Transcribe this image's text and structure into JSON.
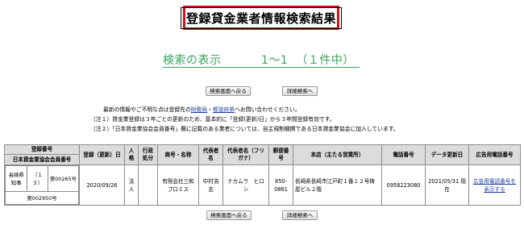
{
  "page": {
    "title": "登録貸金業者情報検索結果",
    "results_label": "検索の表示",
    "results_range": "1〜1",
    "results_count": "（１件中）"
  },
  "buttons": {
    "back": "検索画面へ戻る",
    "detail": "詳細検索へ"
  },
  "notes": {
    "line1_prefix": "最新の情報やご不明な点は登録先の",
    "link_finance": "財務局",
    "separator": "・",
    "link_pref": "都道府県",
    "line1_suffix": "へお問い合わせください。",
    "line2": "（注１）貸金業登録は３年ごとの更新のため、基本的に「登録(更新)日」から３年間登録有効です。",
    "line3": "（注２）「日本貸金業協会会員番号」欄に記載のある業者については、自主規制機関である日本貸金業協会に加入しています。"
  },
  "table": {
    "headers": {
      "reg_no": "登録番号",
      "assoc_no": "日本貸金業協会会員番号",
      "reg_date": "登録（更新）日",
      "personality": "人格",
      "admin_action": "行政処分",
      "name": "商号・名称",
      "rep": "代表者名",
      "rep_kana": "代表者名（フリガナ）",
      "zip": "郵便番号",
      "address": "本店（主たる営業所）",
      "phone": "電話番号",
      "updated": "データ更新日",
      "ad_phone": "広告用電話番号"
    },
    "row": {
      "reg_authority": "長崎県知事",
      "reg_term": "（１３）",
      "reg_number": "第00265号",
      "assoc_number": "第002950号",
      "reg_date": "2020/09/26",
      "personality": "法人",
      "admin_action": "",
      "name": "有限会社三和プロミス",
      "rep": "中村浩志",
      "rep_kana": "ナカムラ　ヒロシ",
      "zip": "850-0861",
      "address": "長崎県長崎市江戸町１番１２号梅屋ビル２階",
      "phone": "0958223080",
      "updated": "2021/05/31 現在",
      "ad_phone_link": "広告用電話番号を表示する"
    }
  }
}
